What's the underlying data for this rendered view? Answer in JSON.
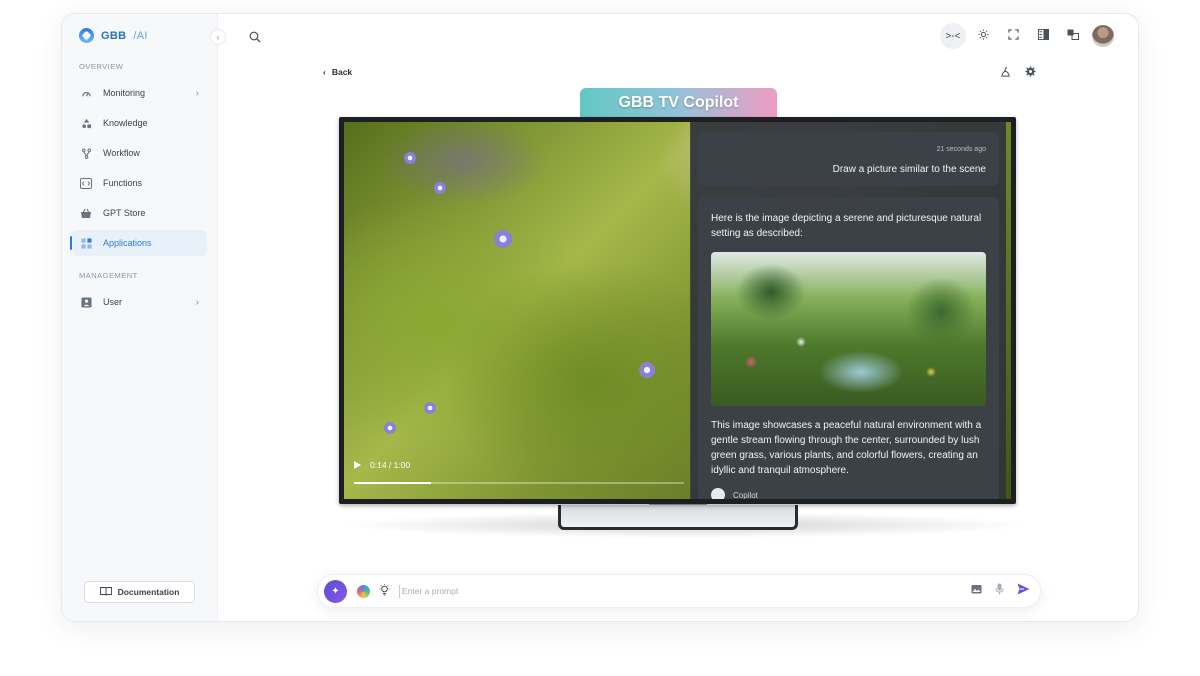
{
  "app": {
    "logo_text": "GBB",
    "logo_suffix": "/AI"
  },
  "sidebar": {
    "sections": [
      {
        "title": "OVERVIEW",
        "items": [
          {
            "label": "Monitoring",
            "icon": "gauge-icon",
            "has_chevron": true
          },
          {
            "label": "Knowledge",
            "icon": "shapes-icon"
          },
          {
            "label": "Workflow",
            "icon": "branch-icon"
          },
          {
            "label": "Functions",
            "icon": "code-icon"
          },
          {
            "label": "GPT Store",
            "icon": "basket-icon"
          },
          {
            "label": "Applications",
            "icon": "apps-icon",
            "active": true
          }
        ]
      },
      {
        "title": "MANAGEMENT",
        "items": [
          {
            "label": "User",
            "icon": "user-card-icon",
            "has_chevron": true
          }
        ]
      }
    ],
    "documentation_label": "Documentation"
  },
  "header": {
    "back_label": "Back"
  },
  "tv": {
    "title": "GBB TV Copilot",
    "player": {
      "time": "0:14 / 1:00",
      "progress_fraction": 0.233
    },
    "chat": {
      "user_message": {
        "time": "21 seconds ago",
        "text": "Draw a picture similar to the scene"
      },
      "bot_message": {
        "intro": "Here is the image depicting a serene and picturesque natural setting as described:",
        "description": "This image showcases a peaceful natural environment with a gentle stream flowing through the center, surrounded by lush green grass, various plants, and colorful flowers, creating an idyllic and tranquil atmosphere.",
        "author": "Copilot"
      }
    }
  },
  "prompt": {
    "placeholder": "Enter a prompt"
  },
  "colors": {
    "accent": "#2c7be0",
    "send": "#6c4fe0"
  }
}
